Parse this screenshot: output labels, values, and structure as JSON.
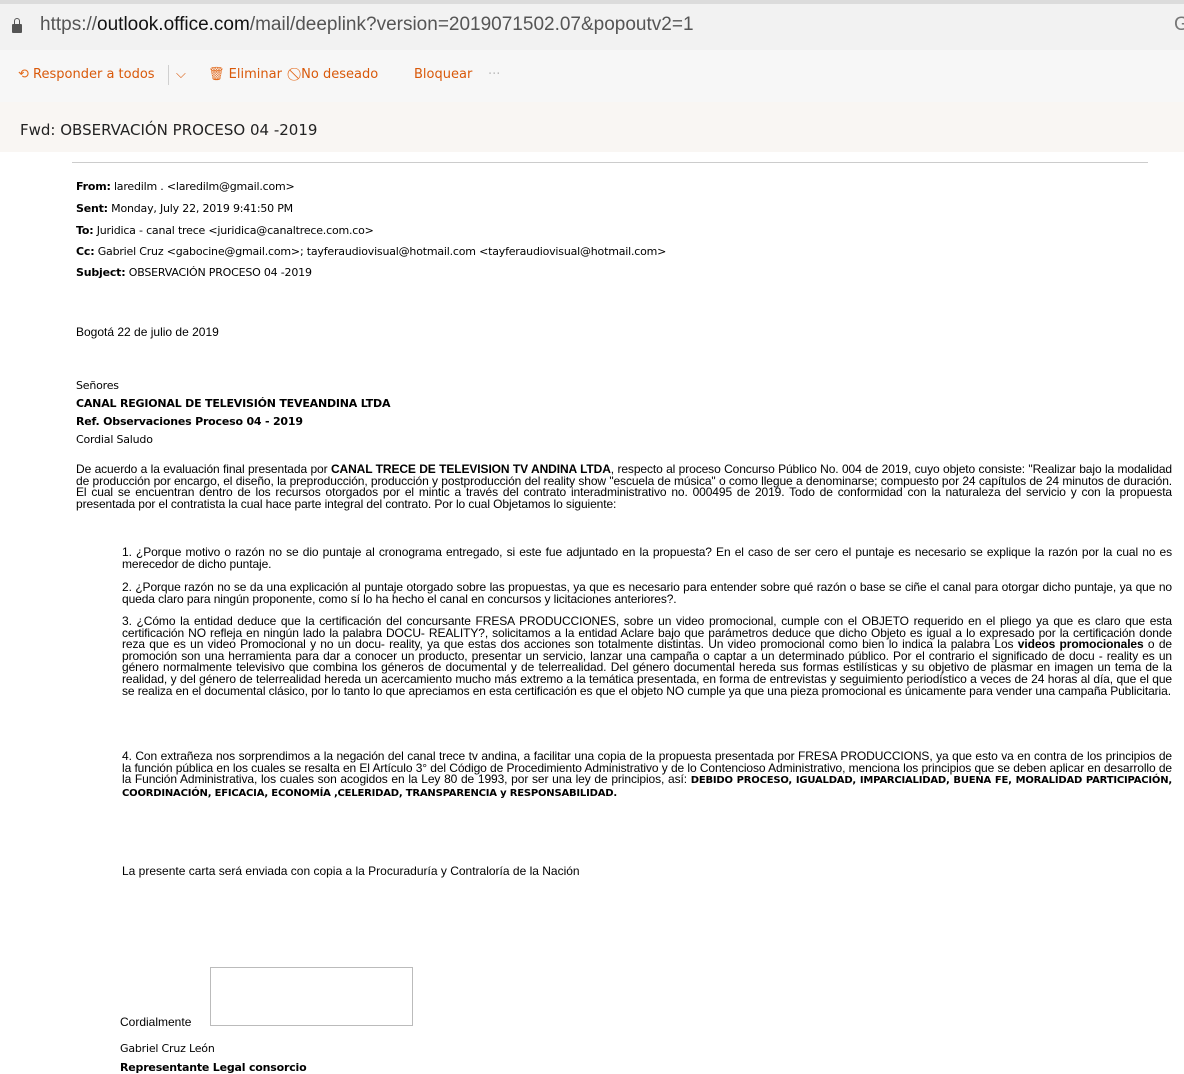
{
  "browser": {
    "url_prefix": "https://",
    "url_host": "outlook.office.com",
    "url_rest": "/mail/deeplink?version=2019071502.07&popoutv2=1",
    "url_right": "G"
  },
  "toolbar": {
    "reply_all": "Responder a todos",
    "delete": "Eliminar",
    "junk": "No deseado",
    "block": "Bloquear",
    "more": "···"
  },
  "message": {
    "subject": "Fwd: OBSERVACIÓN PROCESO 04 -2019",
    "from_label": "From:",
    "from": "laredilm . <laredilm@gmail.com>",
    "sent_label": "Sent:",
    "sent": "Monday, July 22, 2019 9:41:50 PM",
    "to_label": "To:",
    "to": "Juridica - canal trece <juridica@canaltrece.com.co>",
    "cc_label": "Cc:",
    "cc": "Gabriel Cruz <gabocine@gmail.com>; tayferaudiovisual@hotmail.com <tayferaudiovisual@hotmail.com>",
    "subject_label": "Subject:",
    "subject_value": "OBSERVACIÓN PROCESO 04 -2019"
  },
  "letter": {
    "date": "Bogotá 22 de julio de 2019",
    "salutation_to": "Señores",
    "org": "CANAL REGIONAL DE TELEVISIÓN TEVEANDINA LTDA",
    "ref": "Ref. Observaciones Proceso 04 - 2019",
    "greeting": "Cordial Saludo",
    "intro_a": "De acuerdo a la evaluación final presentada por ",
    "intro_bold": "CANAL TRECE DE TELEVISION TV ANDINA LTDA",
    "intro_b": ", respecto al  proceso  Concurso Público No. 004 de 2019, cuyo objeto consiste: \"Realizar bajo la modalidad de producción por encargo, el diseño, la preproducción, producción y postproducción del reality show \"escuela de música\" o como llegue a denominarse; compuesto por 24 capítulos de 24 minutos de duración. El cual se encuentran dentro de los recursos otorgados por el mintic a través del contrato interadministrativo no. 000495 de 2019. Todo de conformidad con la naturaleza del servicio y con la propuesta presentada por el contratista la cual hace parte integral del contrato. Por lo cual Objetamos lo siguiente:",
    "item1": "1.  ¿Porque motivo o razón no se dio puntaje al cronograma entregado, si  este fue adjuntado en la propuesta? En el caso de ser cero el puntaje es necesario se explique la razón por la cual no es merecedor de dicho puntaje.",
    "item2": "2.  ¿Porque razón no se da una explicación al puntaje otorgado sobre las propuestas, ya que es necesario para entender sobre qué razón o base se ciñe el canal para otorgar dicho puntaje, ya que no queda claro para ningún proponente, como sí lo ha hecho el canal en concursos y licitaciones anteriores?.",
    "item3_a": "3.  ¿Cómo la entidad deduce que la certificación del concursante FRESA PRODUCCIONES, sobre un video promocional, cumple con el OBJETO requerido en el pliego ya que es claro que esta certificación NO refleja en ningún lado la palabra DOCU- REALITY?, solicitamos a la entidad Aclare bajo que parámetros deduce que dicho Objeto es igual a lo expresado por la certificación donde reza que es un video Promocional y no un docu- reality, ya que estas dos acciones son totalmente distintas. Un video promocional como bien lo indica la palabra Los ",
    "item3_bold": "videos promocionales",
    "item3_b": " o de promoción son una  herramienta para dar a conocer un producto, presentar un servicio, lanzar una campaña o captar a un determinado público. Por el contrario el significado de docu - reality es un género normalmente televisivo que combina los géneros de documental y de telerrealidad. Del género documental hereda sus formas estilísticas y su objetivo de plasmar en imagen un tema de la realidad, y del género de telerrealidad hereda un acercamiento mucho más extremo a la temática presentada, en forma de entrevistas y seguimiento periodístico a veces de 24 horas al día, que el que se realiza en el documental clásico, por lo tanto lo que apreciamos en esta certificación es que el objeto NO cumple ya que una pieza promocional es únicamente para vender una campaña Publicitaria.",
    "item4_a": "4.  Con extrañeza nos sorprendimos a la negación del canal trece tv andina,  a facilitar una copia de la propuesta presentada por FRESA PRODUCCIONS, ya que esto va en contra de los principios de la función pública en los cuales se resalta en El Artículo 3° del Código de Procedimiento Administrativo y de lo Contencioso Administrativo, menciona los principios que se deben aplicar en desarrollo de la Función Administrativa, los cuales son acogidos en la Ley 80 de 1993, por ser una ley de principios, así: ",
    "item4_bold": "DEBIDO PROCESO, IGUALDAD, IMPARCIALIDAD, BUENA FE, MORALIDAD PARTICIPACIÓN, COORDINACIÓN, EFICACIA, ECONOMÍA ,CELERIDAD, TRANSPARENCIA y RESPONSABILIDAD.",
    "copy_note": "La presente carta será enviada con copia  a la Procuraduría y  Contraloría de la Nación",
    "closing": "Cordialmente",
    "signer": "Gabriel Cruz León",
    "signer_title": "Representante Legal consorcio"
  }
}
